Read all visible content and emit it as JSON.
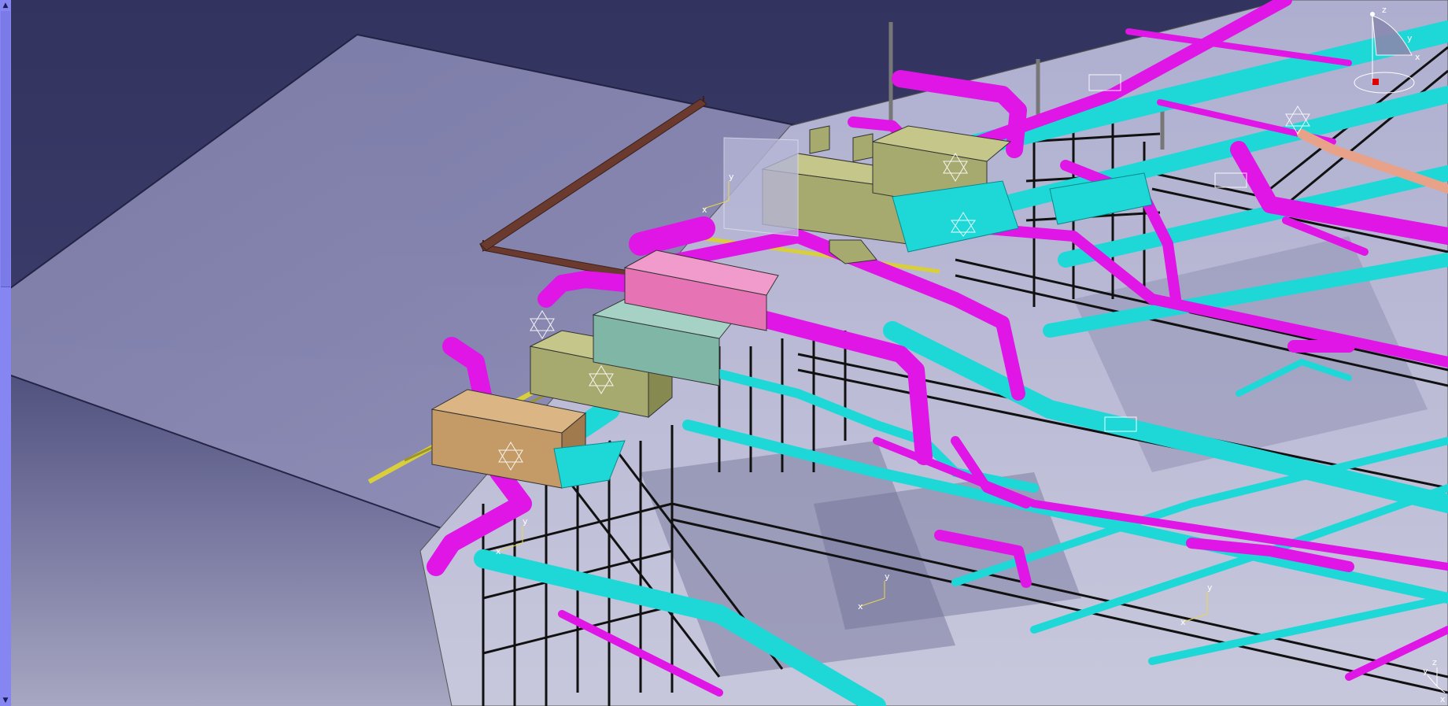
{
  "scrollbar": {
    "up_glyph": "▲",
    "down_glyph": "▼"
  },
  "compass": {
    "labels": [
      "z",
      "y",
      "x"
    ]
  },
  "mini_axis": {
    "labels": [
      "z",
      "y",
      "x"
    ]
  },
  "local_axes": [
    {
      "label_a": "y",
      "label_b": "x"
    },
    {
      "label_a": "y",
      "label_b": "x"
    },
    {
      "label_a": "y",
      "label_b": "x"
    },
    {
      "label_a": "y",
      "label_b": "x"
    }
  ],
  "colors": {
    "background_top": "#33335f",
    "background_bottom": "#a7a7c2",
    "pipe_magenta": "#e016e6",
    "pipe_cyan": "#1ed8d8",
    "equipment_olive": "#a7aa6e",
    "equipment_pink": "#e673b4",
    "equipment_tan": "#c49a66",
    "structure_black": "#111111",
    "floor_plate": "#8585b0",
    "brown_rail": "#6b3a2e",
    "axis_yellow": "#e8d84a"
  }
}
